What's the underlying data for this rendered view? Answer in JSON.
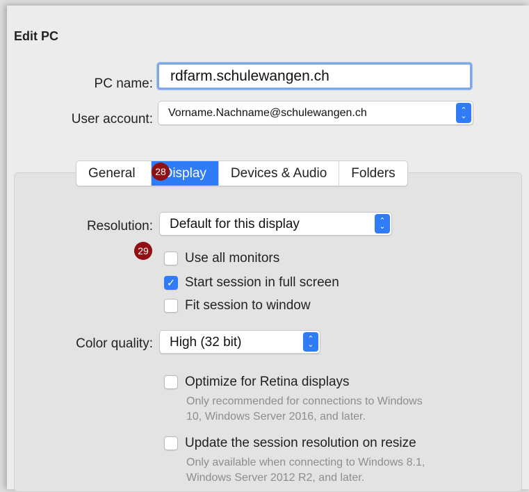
{
  "dialog": {
    "title": "Edit PC"
  },
  "pc_name": {
    "label": "PC name:",
    "value": "rdfarm.schulewangen.ch"
  },
  "user_account": {
    "label": "User account:",
    "value": "Vorname.Nachname@schulewangen.ch"
  },
  "tabs": [
    {
      "label": "General"
    },
    {
      "label": "Display"
    },
    {
      "label": "Devices & Audio"
    },
    {
      "label": "Folders"
    }
  ],
  "selected_tab": "Display",
  "badges": {
    "tabs": "28",
    "monitors": "29"
  },
  "resolution": {
    "label": "Resolution:",
    "value": "Default for this display"
  },
  "checkboxes": {
    "all_monitors": {
      "label": "Use all monitors",
      "checked": false
    },
    "full_screen": {
      "label": "Start session in full screen",
      "checked": true
    },
    "fit_window": {
      "label": "Fit session to window",
      "checked": false
    }
  },
  "color_quality": {
    "label": "Color quality:",
    "value": "High (32 bit)"
  },
  "retina": {
    "label": "Optimize for Retina displays",
    "checked": false,
    "note_line1": "Only recommended for connections to Windows",
    "note_line2": "10, Windows Server 2016, and later."
  },
  "resize": {
    "label": "Update the session resolution on resize",
    "checked": false,
    "note_line1": "Only available when connecting to Windows 8.1,",
    "note_line2": "Windows Server 2012 R2, and later."
  },
  "colors": {
    "accent": "#2f7cf6",
    "badge": "#8f0f12",
    "focus_ring": "#7fa9e6"
  },
  "icons": {
    "stepper": "up-down-chevron-icon",
    "check": "checkmark-icon"
  }
}
